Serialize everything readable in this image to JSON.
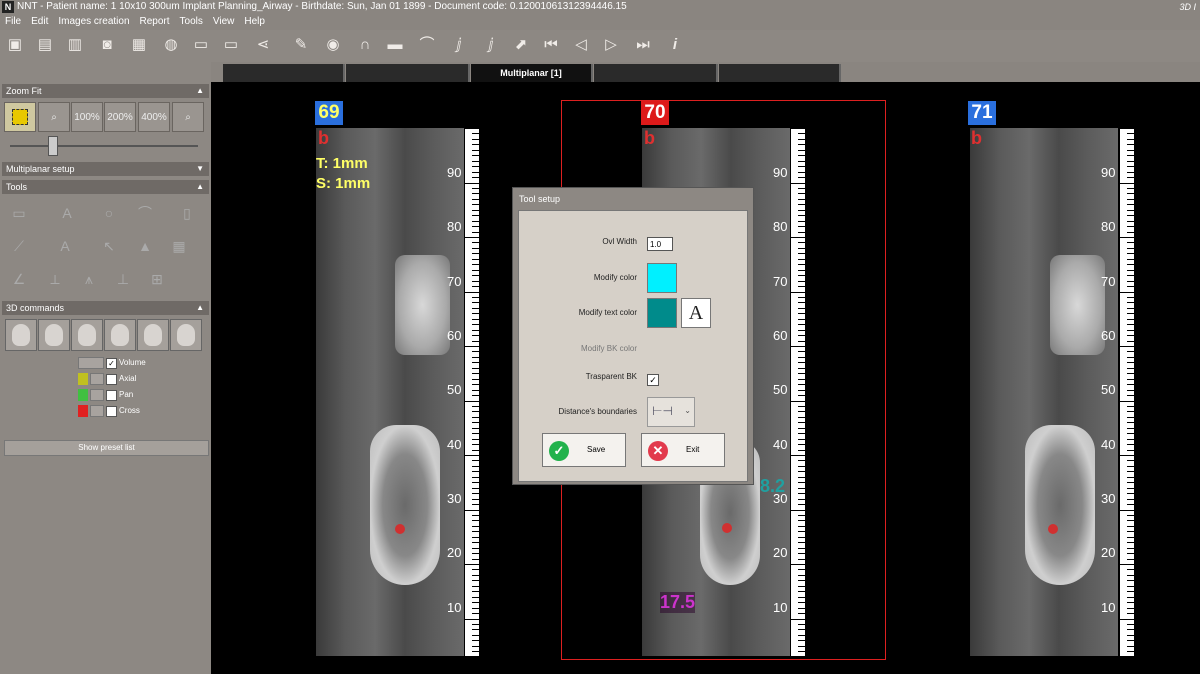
{
  "window": {
    "title": "NNT - Patient name: 1 10x10 300um Implant Planning_Airway - Birthdate: Sun, Jan 01 1899 - Document code: 0.12001061312394446.15",
    "logo_letter": "N",
    "right_label": "3D I"
  },
  "menu": [
    "File",
    "Edit",
    "Images creation",
    "Report",
    "Tools",
    "View",
    "Help"
  ],
  "tabs": {
    "active_label": "Multiplanar [1]"
  },
  "left_panel": {
    "zoom_fit": {
      "header": "Zoom Fit",
      "buttons": [
        "100%",
        "200%",
        "400%"
      ],
      "slider_fraction": 0.25
    },
    "multiplanar_setup": "Multiplanar setup",
    "tools_header": "Tools",
    "commands_header": "3D commands",
    "volume_rows": [
      {
        "label": "Volume",
        "checked": true
      },
      {
        "label": "Axial",
        "checked": false,
        "color": "#c0c020"
      },
      {
        "label": "Pan",
        "checked": false,
        "color": "#40c040"
      },
      {
        "label": "Cross",
        "checked": false,
        "color": "#e02020"
      }
    ],
    "show_preset": "Show preset list"
  },
  "viewer": {
    "slices": [
      {
        "number": "69",
        "bg": "#2a6fdd",
        "fg": "#ffff66",
        "letter": "b"
      },
      {
        "number": "70",
        "bg": "#dd1a1a",
        "fg": "#ffffff",
        "letter": "b"
      },
      {
        "number": "71",
        "bg": "#2a6fdd",
        "fg": "#ffffff",
        "letter": "b"
      }
    ],
    "thickness": "T: 1mm",
    "spacing": "S: 1mm",
    "ruler_labels": [
      "90",
      "80",
      "70",
      "60",
      "50",
      "40",
      "30",
      "20",
      "10"
    ],
    "measure_length": "17.5",
    "measure_width": "8.2"
  },
  "dialog": {
    "title": "Tool setup",
    "ovl_width_label": "Ovl Width",
    "ovl_width_value": "1.0",
    "modify_color_label": "Modify color",
    "modify_color": "#00f0ff",
    "modify_text_color_label": "Modify text color",
    "modify_text_color": "#008b8b",
    "font_button": "A",
    "modify_bk_label": "Modify BK color",
    "transparent_label": "Trasparent BK",
    "distance_label": "Distance's boundaries",
    "save_label": "Save",
    "exit_label": "Exit"
  }
}
